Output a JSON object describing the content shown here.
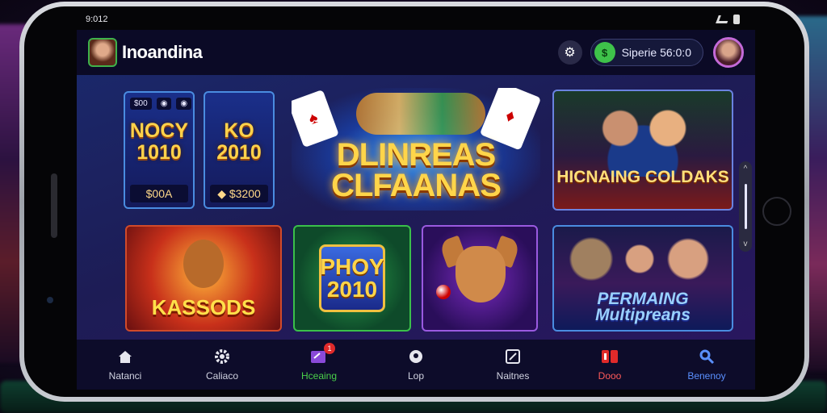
{
  "status_bar": {
    "time": "9:012"
  },
  "header": {
    "username": "Inoandina",
    "balance_text": "Siperie 56:0:0",
    "coin_icon": "coin-icon",
    "settings_icon": "gear-icon"
  },
  "games": {
    "small_1": {
      "tags": [
        "$00",
        "◉",
        "◉"
      ],
      "title": "NOCY 1010",
      "footer": "$00A"
    },
    "small_2": {
      "tags": [],
      "title": "KO 2010",
      "footer": "◆ $3200"
    },
    "hero": {
      "title": "DLINREAS CLFAANAS"
    },
    "feature": {
      "title": "HICNAING COLDAKS"
    },
    "kassods": {
      "title": "KASSODS"
    },
    "phoy": {
      "title": "PHOY 2010"
    },
    "dog": {},
    "multi": {
      "title": "PERMAING Multipreans"
    }
  },
  "nav": {
    "items": [
      {
        "label": "Natanci",
        "icon": "home-icon"
      },
      {
        "label": "Caliaco",
        "icon": "gear-icon"
      },
      {
        "label": "Hceaing",
        "icon": "notification-icon",
        "badge": "1"
      },
      {
        "label": "Lop",
        "icon": "chat-icon"
      },
      {
        "label": "Naitnes",
        "icon": "cards-icon"
      },
      {
        "label": "Dooo",
        "icon": "deck-icon"
      },
      {
        "label": "Benenoy",
        "icon": "search-icon"
      }
    ]
  },
  "colors": {
    "accent_green": "#3ec24a",
    "accent_blue": "#5a90ff",
    "accent_red": "#e02a2a"
  }
}
